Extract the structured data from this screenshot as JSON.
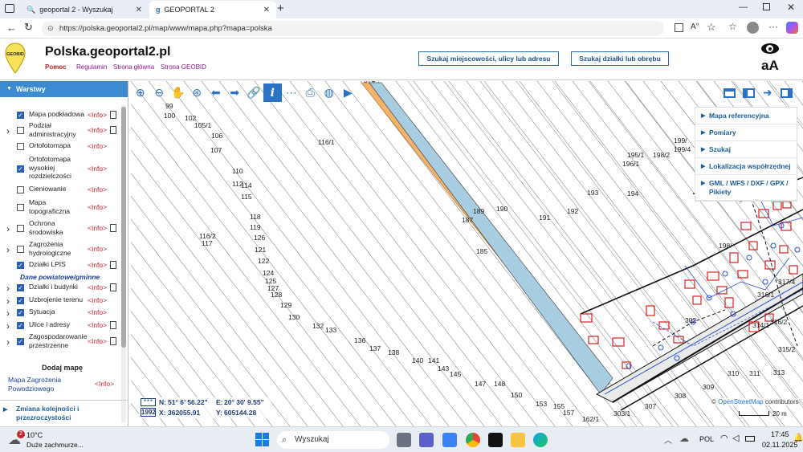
{
  "browser": {
    "tabs": [
      {
        "label": "geoportal 2 - Wyszukaj",
        "active": false
      },
      {
        "label": "GEOPORTAL 2",
        "active": true
      }
    ],
    "url": "https://polska.geoportal2.pl/map/www/mapa.php?mapa=polska"
  },
  "header": {
    "logo_text": "GEOBID",
    "title": "Polska.geoportal2.pl",
    "links": [
      "Pomoc",
      "Regulamin",
      "Strona główna",
      "Strona GEOBID"
    ],
    "btn_search_place": "Szukaj miejscowości, ulicy lub adresu",
    "btn_search_parcel": "Szukaj działki lub obrębu",
    "font_toggle": "aA"
  },
  "sidebar": {
    "title": "Warstwy",
    "layers": [
      {
        "label": "Mapa podkładowa",
        "checked": true,
        "expand": false,
        "info": "<Info>",
        "doc": true
      },
      {
        "label": "Podział administracyjny",
        "checked": false,
        "expand": true,
        "info": "<Info>",
        "doc": true
      },
      {
        "label": "Ortofotomapa",
        "checked": false,
        "expand": false,
        "info": "<Info>",
        "doc": false
      },
      {
        "label": "Ortofotomapa wysokiej rozdzielczości",
        "checked": true,
        "expand": false,
        "info": "<Info>",
        "doc": false
      },
      {
        "label": "Cieniowanie",
        "checked": false,
        "expand": false,
        "info": "<Info>",
        "doc": false
      },
      {
        "label": "Mapa topograficzna",
        "checked": false,
        "expand": false,
        "info": "<Info>",
        "doc": false
      },
      {
        "label": "Ochrona środowiska",
        "checked": false,
        "expand": true,
        "info": "<Info>",
        "doc": true
      },
      {
        "label": "Zagrożenia hydrologiczne",
        "checked": false,
        "expand": true,
        "info": "<Info>",
        "doc": false
      },
      {
        "label": "Działki LPIS",
        "checked": true,
        "expand": false,
        "info": "<Info>",
        "doc": true
      }
    ],
    "subheading": "Dane powiatowe/gminne",
    "layers2": [
      {
        "label": "Działki i budynki",
        "checked": true,
        "expand": true,
        "info": "<Info>",
        "doc": true
      },
      {
        "label": "Uzbrojenie terenu",
        "checked": true,
        "expand": true,
        "info": "<Info>",
        "doc": false
      },
      {
        "label": "Sytuacja",
        "checked": true,
        "expand": true,
        "info": "<Info>",
        "doc": false
      },
      {
        "label": "Ulice i adresy",
        "checked": true,
        "expand": true,
        "info": "<Info>",
        "doc": true
      },
      {
        "label": "Zagospodarowanie przestrzenne",
        "checked": true,
        "expand": true,
        "info": "<Info>",
        "doc": true
      }
    ],
    "add_map_title": "Dodaj mapę",
    "add_map_item": "Mapa Zagrożenia Powodziowego",
    "add_map_info": "<Info>",
    "footer_link": "Zmiana kolejności i przezroczystości"
  },
  "toolbar": {
    "icons": [
      "zoom-in-icon",
      "zoom-out-icon",
      "pan-hand-icon",
      "zoom-window-icon",
      "back-arrow-icon",
      "forward-arrow-icon",
      "link-icon",
      "info-icon",
      "measure-icon",
      "print-icon",
      "globe-icon",
      "video-icon"
    ]
  },
  "right_panel": {
    "items": [
      "Mapa referencyjna",
      "Pomiary",
      "Szukaj",
      "Lokalizacja współrzędnej",
      "GML / WFS / DXF / GPX / Pikiety"
    ]
  },
  "map": {
    "parcel_labels": [
      "99",
      "100",
      "102",
      "105/1",
      "106",
      "107",
      "110",
      "112",
      "114",
      "115",
      "116/1",
      "118",
      "119",
      "116/2",
      "117",
      "126",
      "121",
      "122",
      "124",
      "125",
      "127",
      "128",
      "129",
      "130",
      "132",
      "133",
      "136",
      "137",
      "138",
      "140",
      "141",
      "143",
      "145",
      "147",
      "148",
      "150",
      "153",
      "155",
      "157",
      "162/1",
      "185",
      "187",
      "189",
      "190",
      "191",
      "192",
      "193",
      "194",
      "195/1",
      "196/1",
      "198/2",
      "199/4",
      "199/",
      "198/",
      "302",
      "303/1",
      "307",
      "308",
      "309",
      "310",
      "311",
      "313",
      "315/2",
      "316/1",
      "317/4",
      "314/1",
      "316/2",
      "374"
    ],
    "attribution_prefix": "© ",
    "attribution_link": "OpenStreetMap",
    "attribution_suffix": " contributors",
    "scale_label": "20 m"
  },
  "coords": {
    "n_label": "N:",
    "n_value": "51° 6' 56.22\"",
    "e_label": "E:",
    "e_value": "20° 30' 9.55\"",
    "x_label": "X:",
    "x_value": "362055.91",
    "y_label": "Y:",
    "y_value": "605144.28",
    "system": "1992",
    "system_top": "* * *"
  },
  "taskbar": {
    "weather_temp": "10°C",
    "weather_desc": "Duże zachmurze...",
    "weather_badge": "2",
    "search_placeholder": "Wyszukaj",
    "language": "POL",
    "time": "17:45",
    "date": "02.11.2025"
  },
  "colors": {
    "accent": "#3a8bd1",
    "info_red": "#c0262d",
    "parcel_orange": "#f4b26b",
    "road_blue": "#a9cde0"
  }
}
